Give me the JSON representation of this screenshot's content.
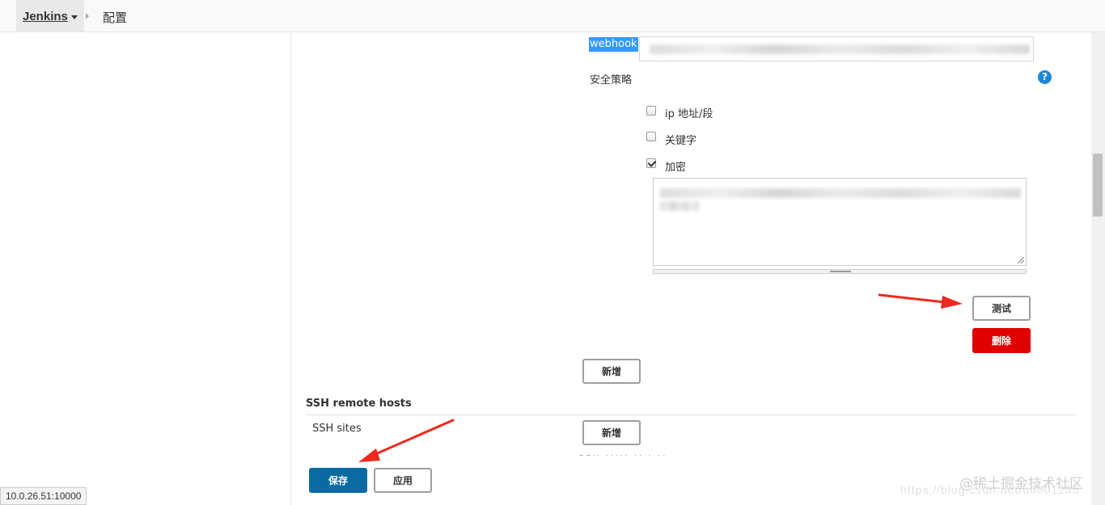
{
  "breadcrumb": {
    "root": "Jenkins",
    "current": "配置"
  },
  "webhook": {
    "label": "webhook"
  },
  "security": {
    "label": "安全策略",
    "help": "?",
    "options": [
      {
        "label": "ip 地址/段",
        "checked": false
      },
      {
        "label": "关键字",
        "checked": false
      },
      {
        "label": "加密",
        "checked": true
      }
    ]
  },
  "buttons": {
    "test": "测试",
    "delete": "删除",
    "add": "新增",
    "save": "保存",
    "apply": "应用"
  },
  "ssh": {
    "heading": "SSH remote hosts",
    "sites_label": "SSH sites",
    "add": "新增"
  },
  "status_bar": {
    "url": "10.0.26.51:10000"
  },
  "watermark": {
    "line1": "@稀土掘金技术社区",
    "line2": "https://blog.csdn.net/u0001235"
  },
  "colors": {
    "primary": "#0b6aa2",
    "danger": "#e00000",
    "highlight": "#3399ff",
    "annotation": "#f0281e",
    "help": "#1e88d6"
  }
}
